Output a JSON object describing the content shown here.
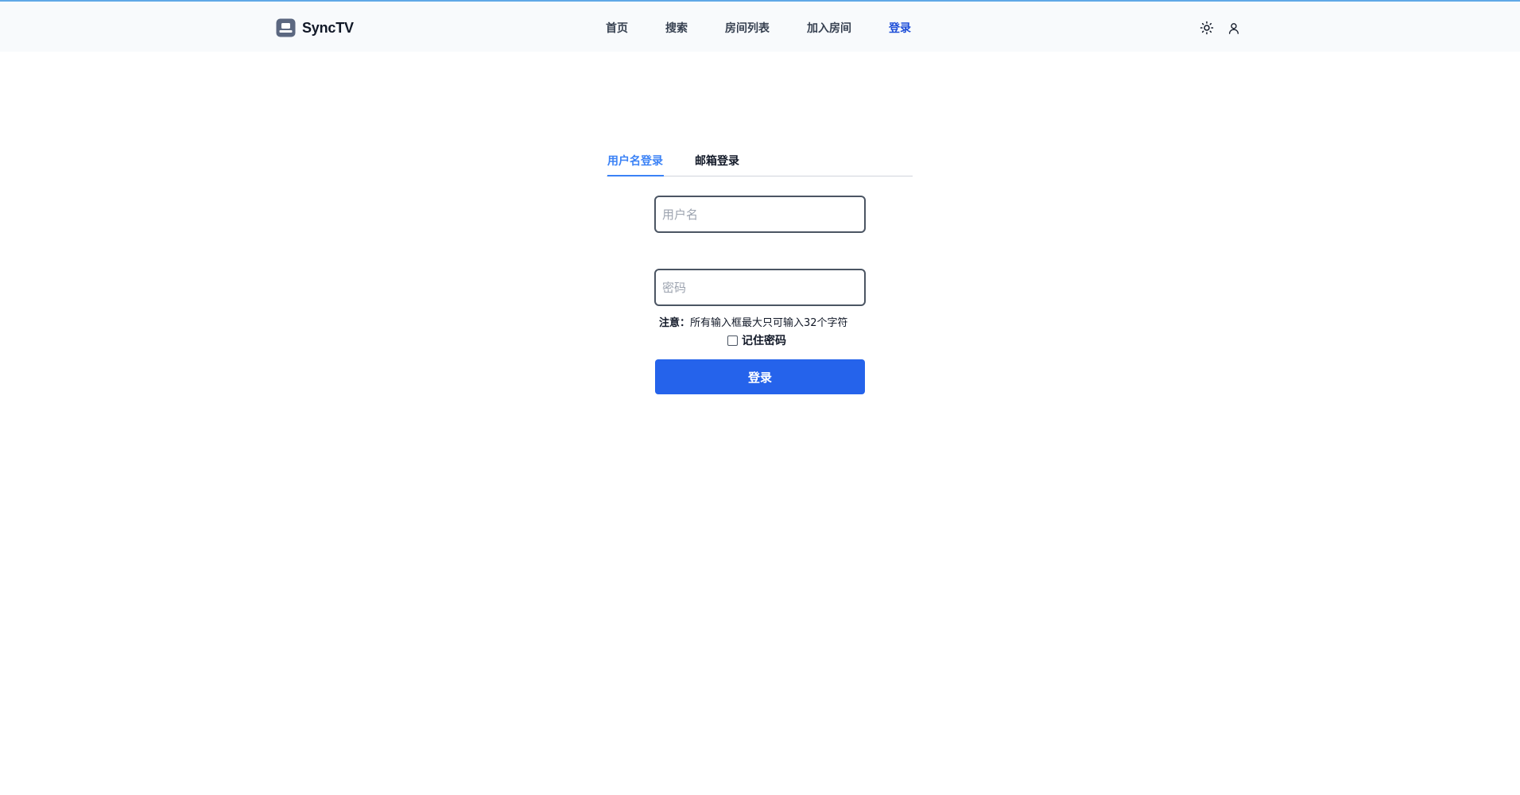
{
  "app": {
    "brand_name": "SyncTV",
    "accent_color": "#2563eb",
    "link_active_color": "#3b82f6"
  },
  "header": {
    "nav": [
      {
        "label": "首页",
        "active": false
      },
      {
        "label": "搜索",
        "active": false
      },
      {
        "label": "房间列表",
        "active": false
      },
      {
        "label": "加入房间",
        "active": false
      },
      {
        "label": "登录",
        "active": true
      }
    ],
    "actions": [
      {
        "icon": "sun-icon",
        "purpose": "theme-toggle"
      },
      {
        "icon": "user-icon",
        "purpose": "account"
      }
    ]
  },
  "login": {
    "tabs": [
      {
        "label": "用户名登录",
        "active": true
      },
      {
        "label": "邮箱登录",
        "active": false
      }
    ],
    "username": {
      "value": "",
      "placeholder": "用户名"
    },
    "password": {
      "value": "",
      "placeholder": "密码"
    },
    "notice_label": "注意：",
    "notice_text": "所有输入框最大只可输入32个字符",
    "remember_label": "记住密码",
    "remember_checked": false,
    "submit_label": "登录"
  }
}
